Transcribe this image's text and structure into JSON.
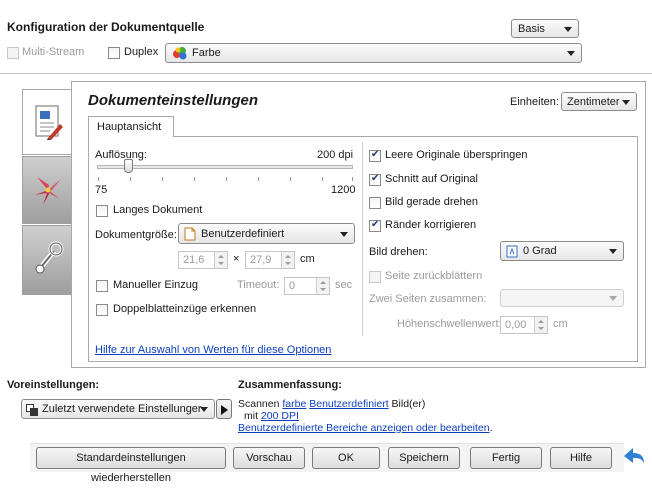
{
  "header": {
    "title": "Konfiguration der Dokumentquelle",
    "mode_select": "Basis",
    "multistream_label": "Multi-Stream",
    "duplex_label": "Duplex",
    "color_select": "Farbe"
  },
  "panel": {
    "title": "Dokumenteinstellungen",
    "units_label": "Einheiten:",
    "units_value": "Zentimeter",
    "tab_main": "Hauptansicht"
  },
  "left": {
    "resolution_label": "Auflösung:",
    "resolution_value": "200 dpi",
    "resolution_min": "75",
    "resolution_max": "1200",
    "resolution_fraction": 0.12,
    "long_doc_label": "Langes Dokument",
    "doc_size_label": "Dokumentgröße:",
    "doc_size_value": "Benutzerdefiniert",
    "width_value": "21,6",
    "times_sign": "×",
    "height_value": "27,9",
    "unit_cm": "cm",
    "manual_feed_label": "Manueller Einzug",
    "timeout_label": "Timeout:",
    "timeout_value": "0",
    "timeout_unit": "sec",
    "double_feed_label": "Doppelblatteinzüge erkennen",
    "help_link": "Hilfe zur Auswahl von Werten für diese Optionen"
  },
  "right": {
    "skip_blank_label": "Leere Originale überspringen",
    "crop_label": "Schnitt auf Original",
    "straighten_label": "Bild gerade drehen",
    "edges_label": "Ränder korrigieren",
    "rotate_label": "Bild drehen:",
    "rotate_value": "0 Grad",
    "flip_label": "Seite zurückblättern",
    "merge_label": "Zwei Seiten zusammen:",
    "merge_value": "",
    "threshold_label": "Höhenschwellenwert:",
    "threshold_value": "0,00",
    "threshold_unit": "cm"
  },
  "presets": {
    "label": "Voreinstellungen:",
    "value": "Zuletzt verwendete Einstellunger"
  },
  "summary": {
    "label": "Zusammenfassung:",
    "line1_prefix": "Scannen",
    "line1_color": "farbe",
    "line1_size": "Benutzerdefiniert",
    "line1_suffix": "Bild(er)",
    "line2_prefix": "mit",
    "line2_dpi": "200 DPI",
    "line3_link": "Benutzerdefinierte Bereiche anzeigen oder bearbeiten",
    "line3_suffix": "."
  },
  "buttons": {
    "reset": "Standardeinstellungen wiederherstellen",
    "preview": "Vorschau",
    "ok": "OK",
    "save": "Speichern",
    "done": "Fertig",
    "help": "Hilfe"
  },
  "colors": {
    "link": "#0b3fc0",
    "back_arrow": "#2f7fd4"
  }
}
